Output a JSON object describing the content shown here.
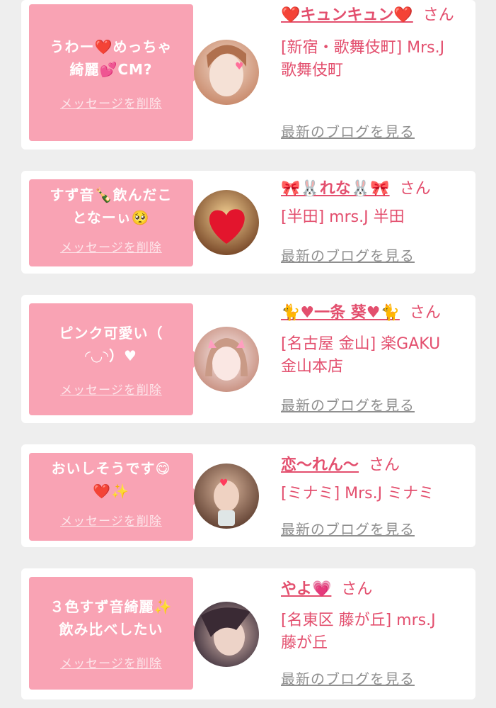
{
  "cards": [
    {
      "message_lines": [
        "うわー❤️めっちゃ",
        "綺麗💕CM?"
      ],
      "delete_label": "メッセージを削除",
      "name": "❤️キュンキュン❤️",
      "honorific": "さん",
      "shop_lines": [
        "[新宿・歌舞伎町] Mrs.J",
        "歌舞伎町"
      ],
      "blog_label": "最新のブログを見る",
      "avatar_colors": [
        "#e6c6b4",
        "#c98b6d"
      ]
    },
    {
      "message_lines": [
        "すず音🍾飲んだこ",
        "となーぃ🥺"
      ],
      "delete_label": "メッセージを削除",
      "name": "🎀🐰れな🐰🎀",
      "honorific": "さん",
      "shop_lines": [
        "[半田] mrs.J 半田"
      ],
      "blog_label": "最新のブログを見る",
      "avatar_colors": [
        "#e8b86c",
        "#7a4a2a"
      ]
    },
    {
      "message_lines": [
        "ピンク可愛い（",
        "◜◡◝）♥"
      ],
      "delete_label": "メッセージを削除",
      "name": "🐈♥一条 葵♥🐈",
      "honorific": "さん",
      "shop_lines": [
        "[名古屋 金山] 楽GAKU",
        "金山本店"
      ],
      "blog_label": "最新のブログを見る",
      "avatar_colors": [
        "#f1e4e6",
        "#c58b7a"
      ]
    },
    {
      "message_lines": [
        "おいしそうです😋",
        "❤️✨"
      ],
      "delete_label": "メッセージを削除",
      "name": "恋〜れん〜",
      "honorific": "さん",
      "shop_lines": [
        "[ミナミ] Mrs.J ミナミ"
      ],
      "blog_label": "最新のブログを見る",
      "avatar_colors": [
        "#6b4a3a",
        "#d9b59c"
      ]
    },
    {
      "message_lines": [
        "３色すず音綺麗✨",
        "飲み比べしたい"
      ],
      "delete_label": "メッセージを削除",
      "name": "やよ💗",
      "honorific": "さん",
      "shop_lines": [
        "[名東区 藤が丘] mrs.J",
        "藤が丘"
      ],
      "blog_label": "最新のブログを見る",
      "avatar_colors": [
        "#3a2a34",
        "#d8b0a4"
      ]
    }
  ]
}
